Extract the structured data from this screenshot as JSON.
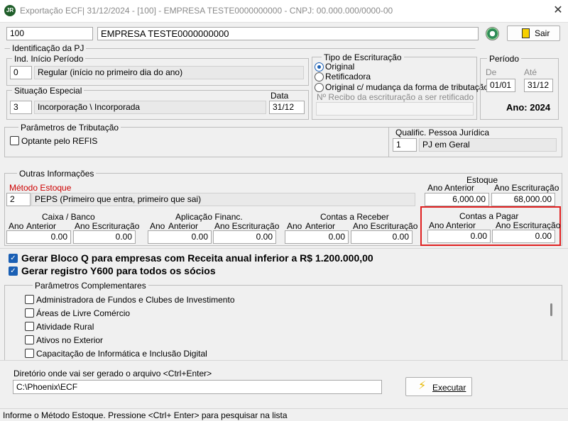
{
  "window": {
    "title": "Exportação ECF| 31/12/2024 - [100] - EMPRESA TESTE0000000000 - CNPJ: 00.000.000/0000-00",
    "app_icon": "JR"
  },
  "header": {
    "company_code": "100",
    "company_name": "EMPRESA TESTE0000000000",
    "exit_label": "Sair"
  },
  "identificacao": {
    "title": "Identificação da PJ",
    "ind_inicio": {
      "title": "Ind. Início Período",
      "code": "0",
      "description": "Regular (início no primeiro dia do ano)"
    },
    "situacao": {
      "title": "Situação Especial",
      "code": "3",
      "description": "Incorporação \\ Incorporada",
      "data_label": "Data",
      "data_value": "31/12"
    }
  },
  "tipo_escrituracao": {
    "title": "Tipo de Escrituração",
    "options": [
      "Original",
      "Retificadora",
      "Original c/ mudança da forma de tributação"
    ],
    "selected": 0,
    "recibo_label": "Nº Recibo da escrituração a ser retificado",
    "recibo_value": ""
  },
  "periodo": {
    "title": "Período",
    "de_label": "De",
    "ate_label": "Até",
    "de_value": "01/01",
    "ate_value": "31/12",
    "ano_text": "Ano: 2024"
  },
  "parametros_tributacao": {
    "title": "Parâmetros de Tributação",
    "optante_refis": "Optante pelo REFIS",
    "qualific_label": "Qualific. Pessoa Jurídica",
    "qualific_code": "1",
    "qualific_desc": "PJ em Geral"
  },
  "outras_informacoes": {
    "title": "Outras Informações",
    "metodo_label": "Método Estoque",
    "metodo_code": "2",
    "metodo_desc": "PEPS (Primeiro que entra, primeiro que sai)",
    "estoque": {
      "title": "Estoque",
      "ano_anterior_label": "Ano Anterior",
      "ano_escrituracao_label": "Ano Escrituração",
      "ano_anterior": "6,000.00",
      "ano_escrituracao": "68,000.00"
    },
    "caixa_banco": {
      "title": "Caixa / Banco",
      "ano_label": "Ano",
      "anterior_label": "Anterior",
      "escrituracao_label": "Ano Escrituração",
      "anterior": "0.00",
      "escrituracao": "0.00"
    },
    "aplicacao": {
      "title": "Aplicação Financ.",
      "ano_label": "Ano",
      "anterior_label": "Anterior",
      "escrituracao_label": "Ano Escrituração",
      "anterior": "0.00",
      "escrituracao": "0.00"
    },
    "contas_receber": {
      "title": "Contas a Receber",
      "ano_label": "Ano",
      "anterior_label": "Anterior",
      "escrituracao_label": "Ano Escrituração",
      "anterior": "0.00",
      "escrituracao": "0.00"
    },
    "contas_pagar": {
      "title": "Contas a Pagar",
      "anterior_label": "Ano Anterior",
      "escrituracao_label": "Ano Escrituração",
      "anterior": "0.00",
      "escrituracao": "0.00"
    }
  },
  "options": {
    "bloco_q": "Gerar Bloco Q para empresas com Receita anual inferior a R$ 1.200.000,00",
    "registro_y600": "Gerar registro Y600 para todos os sócios"
  },
  "parametros_complementares": {
    "title": "Parâmetros Complementares",
    "items": [
      "Administradora de Fundos e Clubes de Investimento",
      "Áreas de Livre Comércio",
      "Atividade Rural",
      "Ativos no Exterior",
      "Capacitação de Informática e Inclusão Digital"
    ]
  },
  "diretorio": {
    "label": "Diretório onde vai ser gerado o arquivo <Ctrl+Enter>",
    "value": "C:\\Phoenix\\ECF",
    "execute_label": "Executar"
  },
  "status": {
    "text": "Informe o Método Estoque. Pressione <Ctrl+ Enter> para pesquisar na lista"
  },
  "colors": {
    "highlight_border": "#e02020",
    "accent": "#1a5fb4",
    "required_label": "#cc0000"
  }
}
